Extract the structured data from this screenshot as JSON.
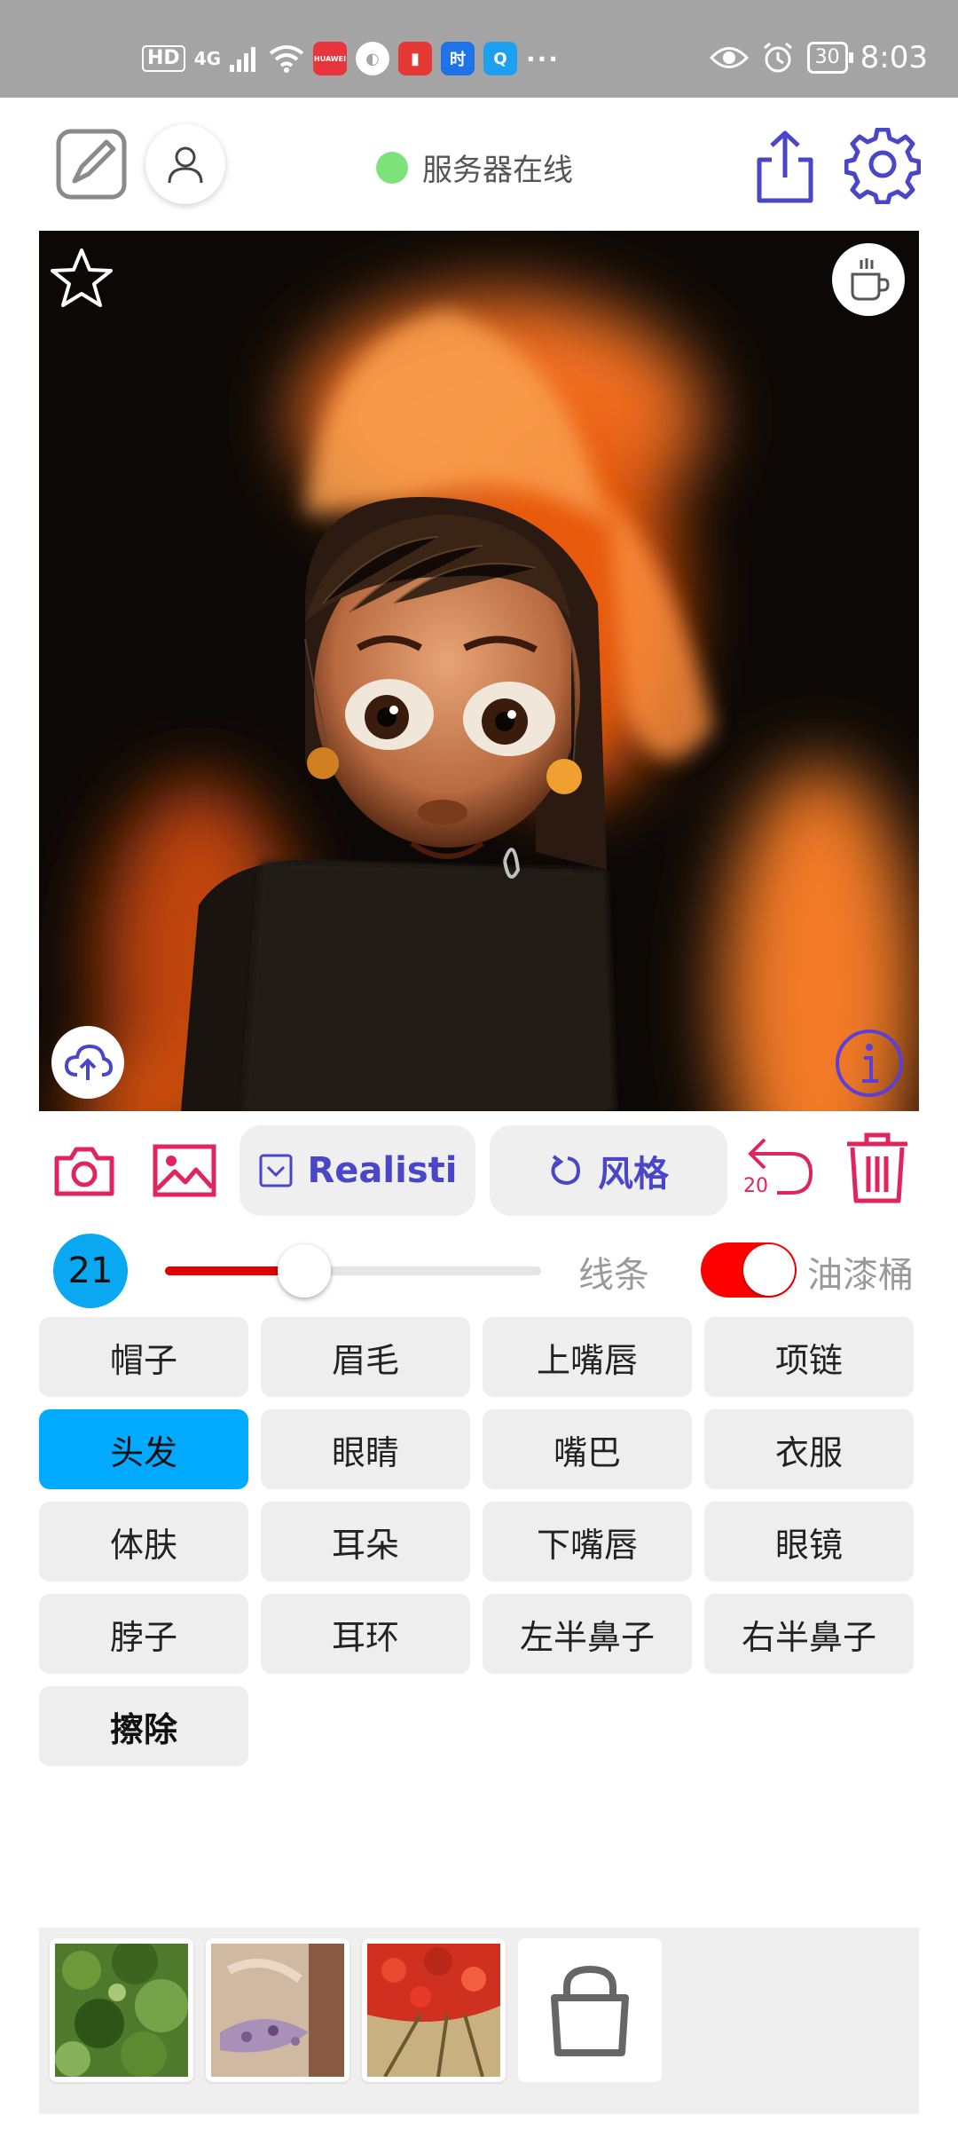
{
  "status_bar": {
    "hd_badge": "HD",
    "network": "4G",
    "app_icons": [
      {
        "name": "huawei-icon",
        "glyph": "HUAWEI",
        "color": "#e8343c"
      },
      {
        "name": "camera-app-icon",
        "glyph": "◐",
        "color": "#a4a4a4"
      },
      {
        "name": "book-app-icon",
        "glyph": "▮",
        "color": "#e53935"
      },
      {
        "name": "time-app-icon",
        "glyph": "时",
        "color": "#1e73e8"
      },
      {
        "name": "search-app-icon",
        "glyph": "Q",
        "color": "#1ea0f0"
      }
    ],
    "more": "···",
    "battery": "30",
    "time": "8:03"
  },
  "toolbar": {
    "server_status": "服务器在线"
  },
  "tool_row": {
    "style_model_label": "Realisti",
    "style_button_label": "风格",
    "undo_count": "20"
  },
  "brush": {
    "size": "21",
    "value_fraction": 0.37,
    "line_label": "线条",
    "bucket_toggle_on": true,
    "bucket_label": "油漆桶"
  },
  "parts": [
    {
      "label": "帽子",
      "selected": false
    },
    {
      "label": "眉毛",
      "selected": false
    },
    {
      "label": "上嘴唇",
      "selected": false
    },
    {
      "label": "项链",
      "selected": false
    },
    {
      "label": "头发",
      "selected": true
    },
    {
      "label": "眼睛",
      "selected": false
    },
    {
      "label": "嘴巴",
      "selected": false
    },
    {
      "label": "衣服",
      "selected": false
    },
    {
      "label": "体肤",
      "selected": false
    },
    {
      "label": "耳朵",
      "selected": false
    },
    {
      "label": "下嘴唇",
      "selected": false
    },
    {
      "label": "眼镜",
      "selected": false
    },
    {
      "label": "脖子",
      "selected": false
    },
    {
      "label": "耳环",
      "selected": false
    },
    {
      "label": "左半鼻子",
      "selected": false
    },
    {
      "label": "右半鼻子",
      "selected": false
    },
    {
      "label": "擦除",
      "selected": false
    }
  ],
  "colors": {
    "accent": "#4a46c8",
    "danger": "#e0245e",
    "selected": "#00aaff",
    "online": "#7ee27a"
  }
}
